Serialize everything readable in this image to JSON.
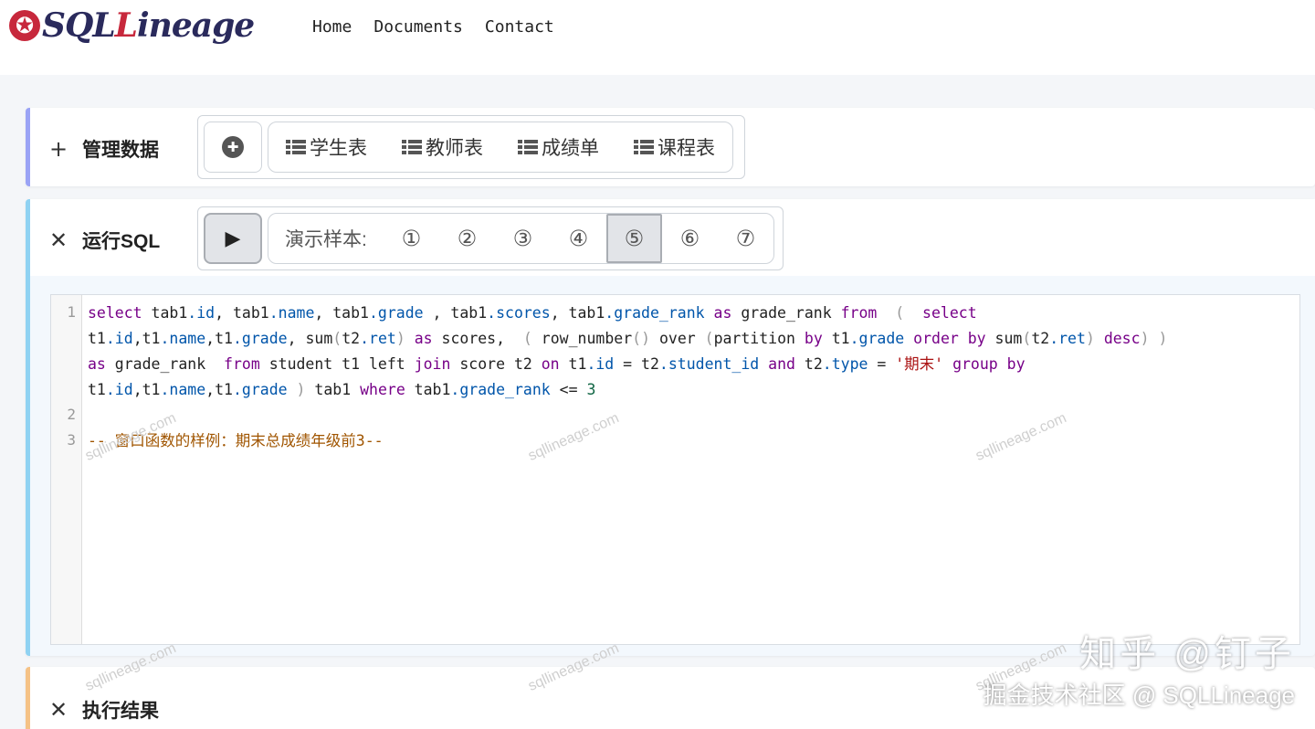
{
  "header": {
    "logo_star": "✪",
    "logo_pre": "SQL",
    "logo_accent": "L",
    "logo_post": "ineage",
    "nav": [
      "Home",
      "Documents",
      "Contact"
    ]
  },
  "data_panel": {
    "toggle_symbol": "+",
    "title": "管理数据",
    "add_symbol": "✚",
    "tables": [
      "学生表",
      "教师表",
      "成绩单",
      "课程表"
    ]
  },
  "sql_panel": {
    "toggle_symbol": "✕",
    "title": "运行SQL",
    "run_symbol": "▶",
    "samples_label": "演示样本:",
    "samples": [
      "①",
      "②",
      "③",
      "④",
      "⑤",
      "⑥",
      "⑦"
    ],
    "active_sample": "⑤",
    "line_numbers": [
      "1",
      "2",
      "3"
    ],
    "comment": "-- 窗口函数的样例：期末总成绩年级前3--"
  },
  "result_panel": {
    "toggle_symbol": "✕",
    "title": "执行结果"
  },
  "watermark": {
    "text": "sqllineage.com",
    "zhihu_line1": "知乎 @钉子",
    "zhihu_line2": "掘金技术社区 @ SQLLineage"
  },
  "colors": {
    "accent_red": "#c7283c",
    "keyword": "#770088",
    "property": "#0055aa",
    "string": "#aa1111",
    "number": "#116644",
    "comment": "#a05500"
  }
}
